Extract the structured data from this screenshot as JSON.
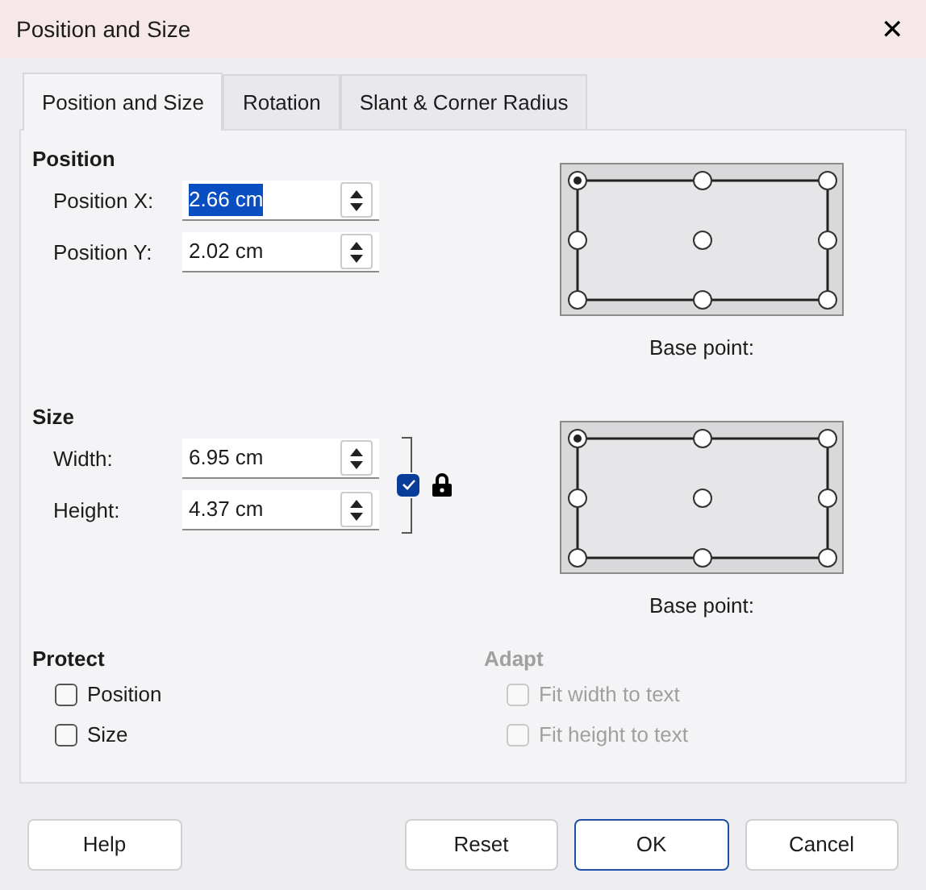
{
  "window": {
    "title": "Position and Size",
    "close": "✕"
  },
  "tabs": [
    {
      "label": "Position and Size",
      "selected": true
    },
    {
      "label": "Rotation",
      "selected": false
    },
    {
      "label": "Slant & Corner Radius",
      "selected": false
    }
  ],
  "sections": [
    {
      "heading": "Position",
      "fields": [
        {
          "label": "Position X:",
          "value": "2.66 cm",
          "text_selected": true
        },
        {
          "label": "Position Y:",
          "value": "2.02 cm",
          "text_selected": false
        }
      ],
      "base_point": {
        "label": "Base point:",
        "points": [
          {
            "selected": true
          },
          {
            "selected": false
          },
          {
            "selected": false
          },
          {
            "selected": false
          },
          {
            "selected": false
          },
          {
            "selected": false
          },
          {
            "selected": false
          },
          {
            "selected": false
          },
          {
            "selected": false
          }
        ]
      }
    },
    {
      "heading": "Size",
      "fields": [
        {
          "label": "Width:",
          "value": "6.95 cm",
          "text_selected": false
        },
        {
          "label": "Height:",
          "value": "4.37 cm",
          "text_selected": false
        }
      ],
      "keep_ratio": {
        "checked": true
      },
      "base_point": {
        "label": "Base point:",
        "points": [
          {
            "selected": true
          },
          {
            "selected": false
          },
          {
            "selected": false
          },
          {
            "selected": false
          },
          {
            "selected": false
          },
          {
            "selected": false
          },
          {
            "selected": false
          },
          {
            "selected": false
          },
          {
            "selected": false
          }
        ]
      }
    }
  ],
  "protect": {
    "heading": "Protect",
    "options": [
      {
        "label": "Position",
        "checked": false,
        "disabled": false
      },
      {
        "label": "Size",
        "checked": false,
        "disabled": false
      }
    ]
  },
  "adapt": {
    "heading": "Adapt",
    "disabled": true,
    "options": [
      {
        "label": "Fit width to text",
        "checked": false,
        "disabled": true
      },
      {
        "label": "Fit height to text",
        "checked": false,
        "disabled": true
      }
    ]
  },
  "buttons": [
    {
      "label": "Help",
      "default": false
    },
    {
      "label": "Reset",
      "default": false
    },
    {
      "label": "OK",
      "default": true
    },
    {
      "label": "Cancel",
      "default": false
    }
  ]
}
